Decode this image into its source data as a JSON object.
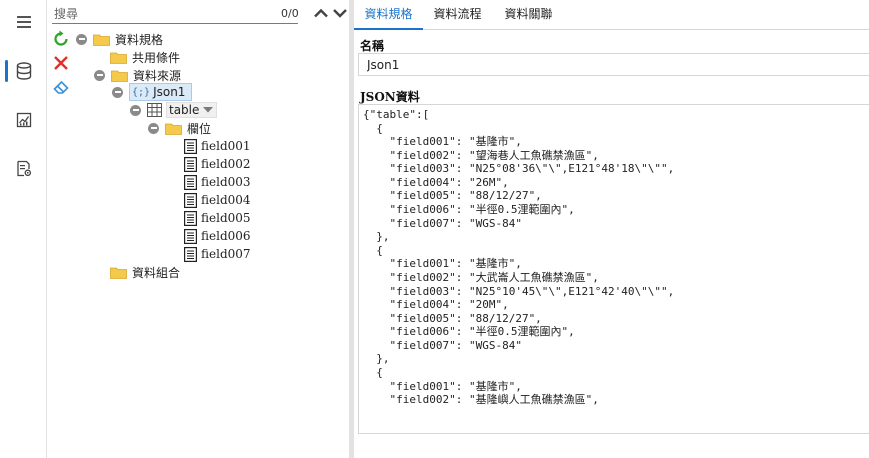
{
  "rail": {
    "items": [
      {
        "icon": "hamburger-menu-icon"
      },
      {
        "icon": "database-icon"
      },
      {
        "icon": "chart-icon"
      },
      {
        "icon": "report-settings-icon"
      }
    ],
    "accent": "#1a73c9"
  },
  "search": {
    "placeholder": "搜尋",
    "count": "0/0"
  },
  "tree": {
    "root": "資料規格",
    "common": "共用條件",
    "source": "資料來源",
    "json_node": "Json1",
    "json_prefix": "{;}",
    "table_node": "table",
    "fields_folder": "欄位",
    "fields": [
      "field001",
      "field002",
      "field003",
      "field004",
      "field005",
      "field006",
      "field007"
    ],
    "combo": "資料組合"
  },
  "tabs": [
    {
      "label": "資料規格",
      "active": true
    },
    {
      "label": "資料流程",
      "active": false
    },
    {
      "label": "資料關聯",
      "active": false
    }
  ],
  "form": {
    "name_label": "名稱",
    "name_value": "Json1",
    "json_label": "JSON資料",
    "json_lines": [
      "{\"table\":[",
      "  {",
      "    \"field001\": \"基隆市\",",
      "    \"field002\": \"望海巷人工魚礁禁漁區\",",
      "    \"field003\": \"N25°08'36\\\"\\\",E121°48'18\\\"\\\"\",",
      "    \"field004\": \"26M\",",
      "    \"field005\": \"88/12/27\",",
      "    \"field006\": \"半徑0.5浬範圍內\",",
      "    \"field007\": \"WGS-84\"",
      "  },",
      "  {",
      "    \"field001\": \"基隆市\",",
      "    \"field002\": \"大武崙人工魚礁禁漁區\",",
      "    \"field003\": \"N25°10'45\\\"\\\",E121°42'40\\\"\\\"\",",
      "    \"field004\": \"20M\",",
      "    \"field005\": \"88/12/27\",",
      "    \"field006\": \"半徑0.5浬範圍內\",",
      "    \"field007\": \"WGS-84\"",
      "  },",
      "  {",
      "    \"field001\": \"基隆市\",",
      "    \"field002\": \"基隆嶼人工魚礁禁漁區\","
    ]
  }
}
